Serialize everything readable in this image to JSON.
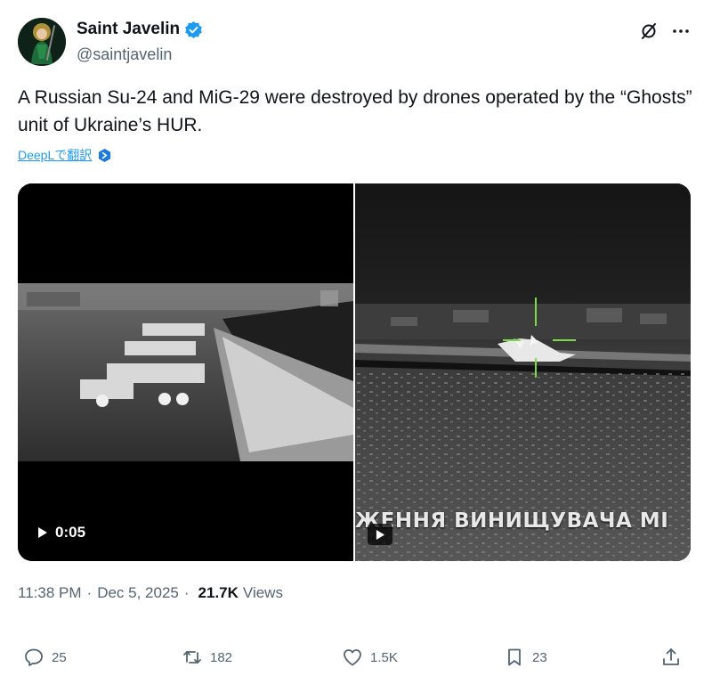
{
  "author": {
    "display_name": "Saint Javelin",
    "handle": "@saintjavelin",
    "verified": true,
    "avatar_icon": "saint-javelin-avatar"
  },
  "tweet": {
    "text": "A Russian Su-24 and MiG-29 were destroyed by drones operated by the “Ghosts” unit of Ukraine’s HUR.",
    "translate_label": "DeepLで翻訳",
    "translate_icon": "deepl-icon"
  },
  "media": {
    "video_duration": "0:05",
    "right_caption": "ЖЕННЯ ВИНИЩУВАЧА МІ"
  },
  "meta": {
    "time": "11:38 PM",
    "date": "Dec 5, 2025",
    "views_count": "21.7K",
    "views_label": "Views"
  },
  "actions": {
    "replies": "25",
    "retweets": "182",
    "likes": "1.5K",
    "bookmarks": "23"
  },
  "colors": {
    "accent": "#1d9bf0",
    "secondary_text": "#536471",
    "primary_text": "#0f1419"
  }
}
